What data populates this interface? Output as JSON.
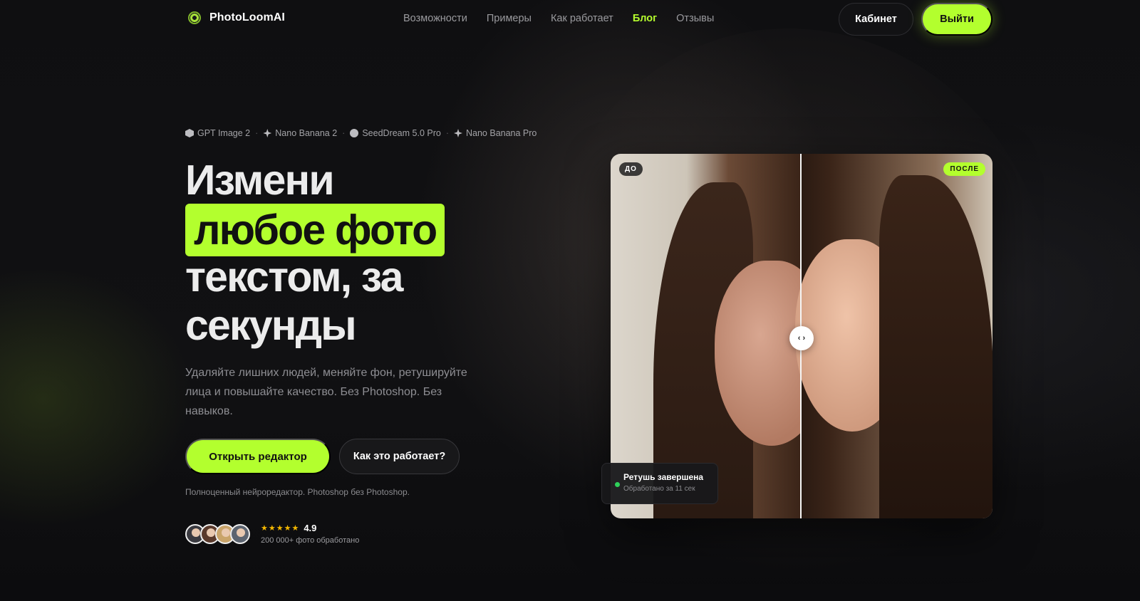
{
  "brand": {
    "name": "PhotoLoomAI",
    "icon": "aperture-icon",
    "accent_color": "#b3ff2e"
  },
  "nav": {
    "links": [
      {
        "label": "Возможности",
        "active": false
      },
      {
        "label": "Примеры",
        "active": false
      },
      {
        "label": "Как работает",
        "active": false
      },
      {
        "label": "Блог",
        "active": true
      },
      {
        "label": "Отзывы",
        "active": false
      }
    ],
    "cabinet_label": "Кабинет",
    "exit_label": "Выйти"
  },
  "models": [
    {
      "label": "GPT Image 2",
      "icon": "hexagon-icon"
    },
    {
      "label": "Nano Banana 2",
      "icon": "sparkle-icon"
    },
    {
      "label": "SeedDream 5.0 Pro",
      "icon": "circle-icon"
    },
    {
      "label": "Nano Banana Pro",
      "icon": "sparkle-icon"
    }
  ],
  "models_separator": "·",
  "hero": {
    "line1": "Измени",
    "line2_highlight": "любое фото",
    "line3": "текстом, за",
    "line4": "секунды",
    "subtitle": "Удаляйте лишних людей, меняйте фон, ретушируйте лица и повышайте качество. Без Photoshop. Без навыков.",
    "primary_cta": "Открыть редактор",
    "secondary_cta": "Как это работает?",
    "tagline": "Полноценный нейроредактор. Photoshop без Photoshop."
  },
  "social_proof": {
    "stars": "★★★★★",
    "rating": "4.9",
    "count": "200 000+ фото обработано"
  },
  "compare": {
    "before_label": "ДО",
    "after_label": "ПОСЛЕ",
    "handle_glyph": "‹ ›",
    "toast_title": "Ретушь завершена",
    "toast_subtitle": "Обработано за 11 сек",
    "status_color": "#2fd15a"
  }
}
